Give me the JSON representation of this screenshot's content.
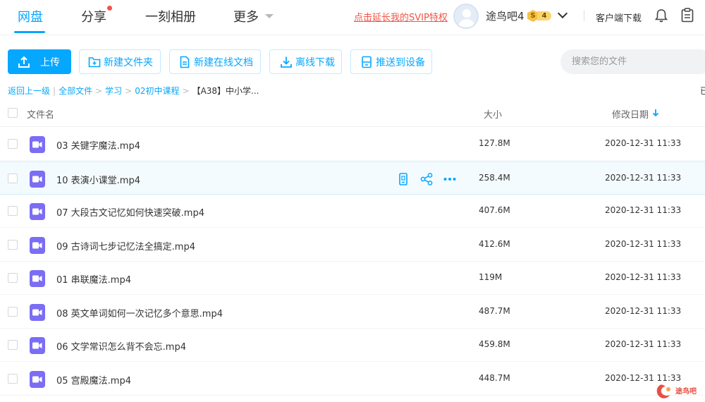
{
  "nav": {
    "tabs": [
      {
        "label": "网盘",
        "active": true
      },
      {
        "label": "分享",
        "has_dot": true
      },
      {
        "label": "一刻相册"
      },
      {
        "label": "更多"
      }
    ],
    "svip_link": "点击延长我的SVIP特权",
    "username": "途鸟吧4",
    "vip_level_letter": "S",
    "vip_level_num": "4",
    "client_download": "客户端下载"
  },
  "toolbar": {
    "upload": "上传",
    "new_folder": "新建文件夹",
    "new_doc": "新建在线文档",
    "offline_download": "离线下载",
    "push_device": "推送到设备",
    "search_placeholder": "搜索您的文件"
  },
  "breadcrumb": {
    "back": "返回上一级",
    "items": [
      "全部文件",
      "学习",
      "02初中课程"
    ],
    "current": "【A38】中小学...",
    "right_text": "已"
  },
  "table": {
    "headers": {
      "name": "文件名",
      "size": "大小",
      "date": "修改日期"
    },
    "rows": [
      {
        "name": "03 关键字魔法.mp4",
        "size": "127.8M",
        "date": "2020-12-31 11:33"
      },
      {
        "name": "10 表演小课堂.mp4",
        "size": "258.4M",
        "date": "2020-12-31 11:33"
      },
      {
        "name": "07 大段古文记忆如何快速突破.mp4",
        "size": "407.6M",
        "date": "2020-12-31 11:33"
      },
      {
        "name": "09 古诗词七步记忆法全搞定.mp4",
        "size": "412.6M",
        "date": "2020-12-31 11:33"
      },
      {
        "name": "01 串联魔法.mp4",
        "size": "119M",
        "date": "2020-12-31 11:33"
      },
      {
        "name": "08 英文单词如何一次记忆多个意思.mp4",
        "size": "487.7M",
        "date": "2020-12-31 11:33"
      },
      {
        "name": "06 文学常识怎么背不会忘.mp4",
        "size": "459.8M",
        "date": "2020-12-31 11:33"
      },
      {
        "name": "05 宫殿魔法.mp4",
        "size": "448.7M",
        "date": "2020-12-31 11:33"
      }
    ]
  },
  "watermark": {
    "text": "途鸟吧"
  },
  "colors": {
    "accent": "#06a7ff",
    "danger": "#f25346",
    "video_icon": "#7b6df5"
  }
}
